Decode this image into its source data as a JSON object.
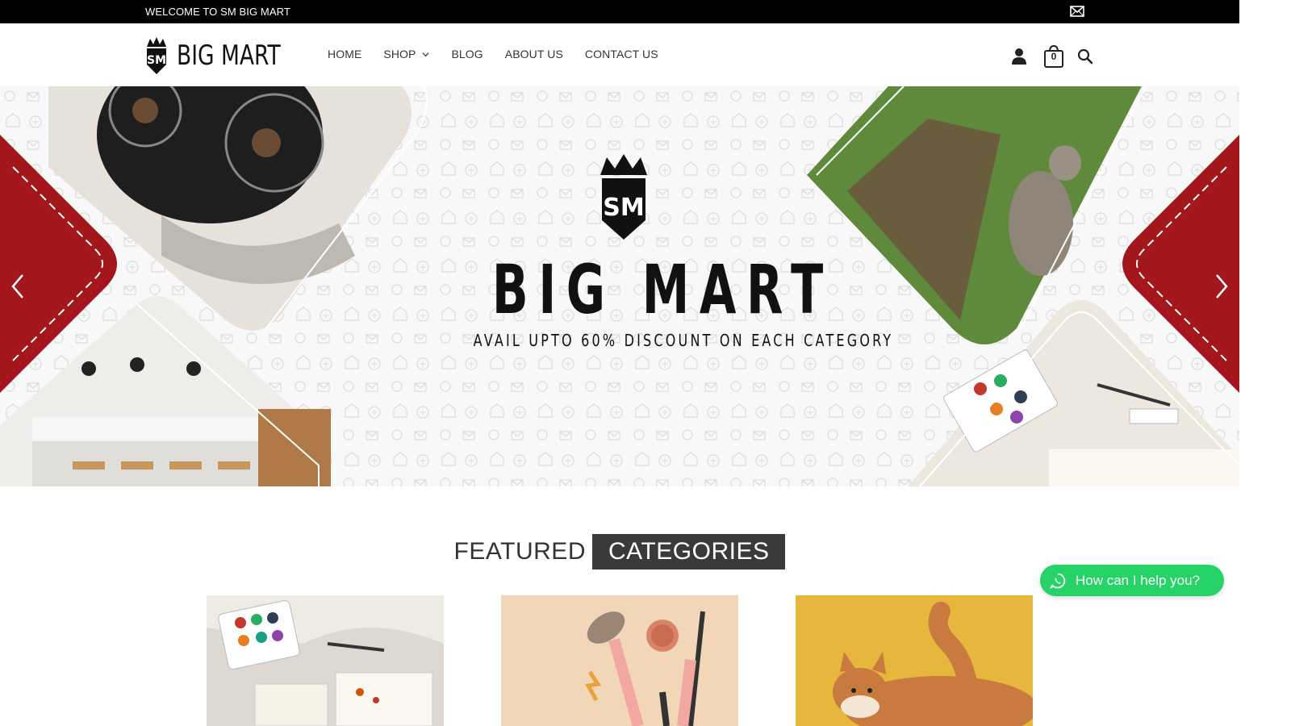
{
  "topbar": {
    "welcome": "WELCOME TO SM BIG MART",
    "mail_icon": "mail-icon"
  },
  "header": {
    "logo_text": "BIG MART",
    "nav": [
      {
        "label": "HOME"
      },
      {
        "label": "SHOP",
        "has_dropdown": true
      },
      {
        "label": "BLOG"
      },
      {
        "label": "ABOUT US"
      },
      {
        "label": "CONTACT US"
      }
    ],
    "cart_count": "0",
    "icons": [
      "user-icon",
      "cart-icon",
      "search-icon"
    ]
  },
  "hero": {
    "brand": "BIG MART",
    "tagline": "AVAIL UPTO 60% DISCOUNT ON EACH CATEGORY",
    "accent_color": "#a3161c"
  },
  "featured": {
    "title_part1": "FEATURED",
    "title_part2": "CATEGORIES"
  },
  "cards": [
    {
      "name": "art-supplies-card"
    },
    {
      "name": "makeup-card"
    },
    {
      "name": "cat-card"
    }
  ],
  "whatsapp": {
    "label": "How can I help you?",
    "color": "#25d366"
  }
}
